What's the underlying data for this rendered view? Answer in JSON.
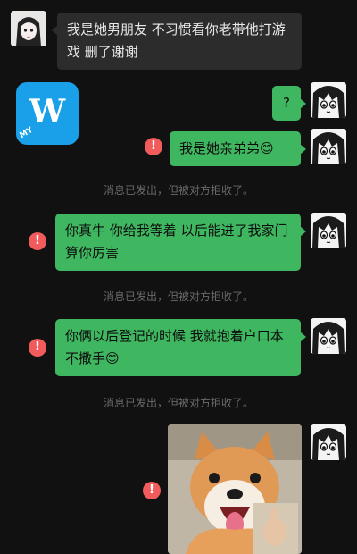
{
  "messages": {
    "m1": "我是她男朋友 不习惯看你老带他打游戏 删了谢谢",
    "m2": "?",
    "m3": "我是她亲弟弟😊",
    "m4": "你真牛 你给我等着 以后能进了我家门算你厉害",
    "m5": "你俩以后登记的时候 我就抱着户口本不撒手😊"
  },
  "system_notice": "消息已发出，但被对方拒收了。",
  "error_symbol": "!",
  "app_icon": {
    "letter": "W",
    "badge": "MY",
    "color": "#1aa0e8"
  },
  "colors": {
    "outgoing": "#3fb760",
    "incoming": "#2c2c2c",
    "error": "#f25b5b",
    "background": "#111111"
  }
}
